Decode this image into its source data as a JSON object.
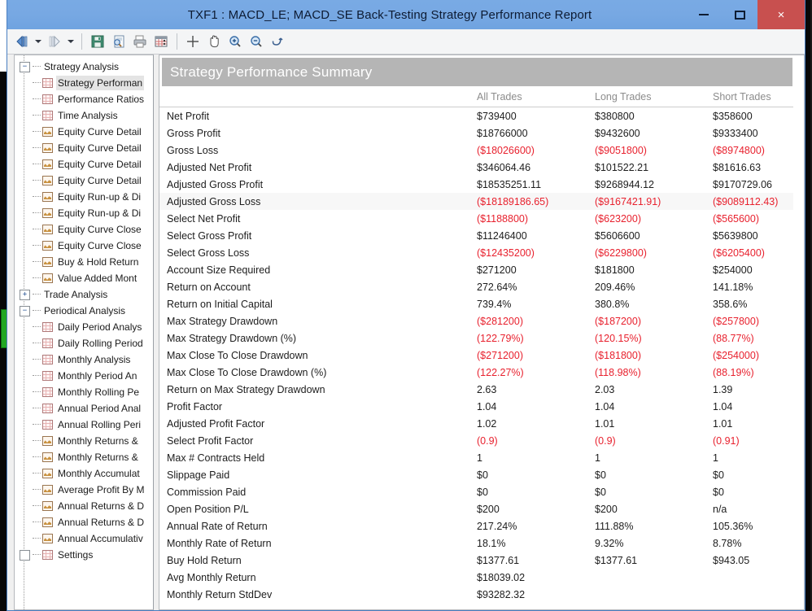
{
  "window": {
    "title": "TXF1 : MACD_LE; MACD_SE Back-Testing Strategy Performance Report",
    "minimize_label": "",
    "maximize_label": "",
    "close_label": "×",
    "accent_titlebar": "#79aae4",
    "accent_close": "#c8504f"
  },
  "toolbar": {
    "items": [
      {
        "name": "back-button",
        "glyph": "◁"
      },
      {
        "name": "back-dropdown",
        "glyph": ""
      },
      {
        "name": "forward-button",
        "glyph": "▷"
      },
      {
        "name": "forward-dropdown",
        "glyph": ""
      },
      {
        "name": "save-button",
        "glyph": ""
      },
      {
        "name": "print-preview-button",
        "glyph": ""
      },
      {
        "name": "print-button",
        "glyph": ""
      },
      {
        "name": "report-settings-button",
        "glyph": ""
      },
      {
        "name": "crosshair-button",
        "glyph": ""
      },
      {
        "name": "pan-hand-button",
        "glyph": ""
      },
      {
        "name": "zoom-in-button",
        "glyph": ""
      },
      {
        "name": "zoom-out-button",
        "glyph": ""
      },
      {
        "name": "reset-zoom-button",
        "glyph": ""
      }
    ]
  },
  "sidebar": {
    "items": [
      {
        "label": "Strategy Analysis",
        "level": 0,
        "icon": "expander-minus",
        "expander": "−",
        "selected": false
      },
      {
        "label": "Strategy Performan",
        "level": 1,
        "icon": "grid",
        "selected": true
      },
      {
        "label": "Performance Ratios",
        "level": 1,
        "icon": "grid",
        "selected": false
      },
      {
        "label": "Time Analysis",
        "level": 1,
        "icon": "grid",
        "selected": false
      },
      {
        "label": "Equity Curve Detail",
        "level": 1,
        "icon": "chart",
        "selected": false
      },
      {
        "label": "Equity Curve Detail",
        "level": 1,
        "icon": "chart",
        "selected": false
      },
      {
        "label": "Equity Curve Detail",
        "level": 1,
        "icon": "chart",
        "selected": false
      },
      {
        "label": "Equity Curve Detail",
        "level": 1,
        "icon": "chart",
        "selected": false
      },
      {
        "label": "Equity Run-up & Di",
        "level": 1,
        "icon": "chart",
        "selected": false
      },
      {
        "label": "Equity Run-up & Di",
        "level": 1,
        "icon": "chart",
        "selected": false
      },
      {
        "label": "Equity Curve Close",
        "level": 1,
        "icon": "chart",
        "selected": false
      },
      {
        "label": "Equity Curve Close",
        "level": 1,
        "icon": "chart",
        "selected": false
      },
      {
        "label": "Buy & Hold Return",
        "level": 1,
        "icon": "chart",
        "selected": false
      },
      {
        "label": "Value Added Mont",
        "level": 1,
        "icon": "chart",
        "selected": false
      },
      {
        "label": "Trade Analysis",
        "level": 0,
        "icon": "expander-plus",
        "expander": "+",
        "selected": false
      },
      {
        "label": "Periodical Analysis",
        "level": 0,
        "icon": "expander-minus",
        "expander": "−",
        "selected": false
      },
      {
        "label": "Daily Period Analys",
        "level": 1,
        "icon": "grid",
        "selected": false
      },
      {
        "label": "Daily Rolling Period",
        "level": 1,
        "icon": "grid",
        "selected": false
      },
      {
        "label": "Monthly Analysis",
        "level": 1,
        "icon": "grid",
        "selected": false
      },
      {
        "label": "Monthly Period An",
        "level": 1,
        "icon": "grid",
        "selected": false
      },
      {
        "label": "Monthly Rolling Pe",
        "level": 1,
        "icon": "grid",
        "selected": false
      },
      {
        "label": "Annual Period Anal",
        "level": 1,
        "icon": "grid",
        "selected": false
      },
      {
        "label": "Annual Rolling Peri",
        "level": 1,
        "icon": "grid",
        "selected": false
      },
      {
        "label": "Monthly Returns &",
        "level": 1,
        "icon": "chart",
        "selected": false
      },
      {
        "label": "Monthly Returns &",
        "level": 1,
        "icon": "chart",
        "selected": false
      },
      {
        "label": "Monthly Accumulat",
        "level": 1,
        "icon": "chart",
        "selected": false
      },
      {
        "label": "Average Profit By M",
        "level": 1,
        "icon": "chart",
        "selected": false
      },
      {
        "label": "Annual Returns & D",
        "level": 1,
        "icon": "chart",
        "selected": false
      },
      {
        "label": "Annual Returns & D",
        "level": 1,
        "icon": "chart",
        "selected": false
      },
      {
        "label": "Annual Accumulativ",
        "level": 1,
        "icon": "chart",
        "selected": false
      },
      {
        "label": "Settings",
        "level": 0,
        "icon": "grid",
        "selected": false
      }
    ]
  },
  "report": {
    "banner_title": "Strategy Performance Summary",
    "columns": [
      "",
      "All Trades",
      "Long Trades",
      "Short Trades"
    ],
    "rows": [
      {
        "label": "Net Profit",
        "all": "$739400",
        "long": "$380800",
        "short": "$358600",
        "negative": false,
        "alt": false
      },
      {
        "label": "Gross Profit",
        "all": "$18766000",
        "long": "$9432600",
        "short": "$9333400",
        "negative": false,
        "alt": false
      },
      {
        "label": "Gross Loss",
        "all": "($18026600)",
        "long": "($9051800)",
        "short": "($8974800)",
        "negative": true,
        "alt": false
      },
      {
        "label": "Adjusted Net Profit",
        "all": "$346064.46",
        "long": "$101522.21",
        "short": "$81616.63",
        "negative": false,
        "alt": false
      },
      {
        "label": "Adjusted Gross Profit",
        "all": "$18535251.11",
        "long": "$9268944.12",
        "short": "$9170729.06",
        "negative": false,
        "alt": false
      },
      {
        "label": "Adjusted Gross Loss",
        "all": "($18189186.65)",
        "long": "($9167421.91)",
        "short": "($9089112.43)",
        "negative": true,
        "alt": true
      },
      {
        "label": "Select Net Profit",
        "all": "($1188800)",
        "long": "($623200)",
        "short": "($565600)",
        "negative": true,
        "alt": false
      },
      {
        "label": "Select Gross Profit",
        "all": "$11246400",
        "long": "$5606600",
        "short": "$5639800",
        "negative": false,
        "alt": false
      },
      {
        "label": "Select Gross Loss",
        "all": "($12435200)",
        "long": "($6229800)",
        "short": "($6205400)",
        "negative": true,
        "alt": false
      },
      {
        "label": "Account Size Required",
        "all": "$271200",
        "long": "$181800",
        "short": "$254000",
        "negative": false,
        "alt": false
      },
      {
        "label": "Return on Account",
        "all": "272.64%",
        "long": "209.46%",
        "short": "141.18%",
        "negative": false,
        "alt": false
      },
      {
        "label": "Return on Initial Capital",
        "all": "739.4%",
        "long": "380.8%",
        "short": "358.6%",
        "negative": false,
        "alt": false
      },
      {
        "label": "Max Strategy Drawdown",
        "all": "($281200)",
        "long": "($187200)",
        "short": "($257800)",
        "negative": true,
        "alt": false
      },
      {
        "label": "Max Strategy Drawdown (%)",
        "all": "(122.79%)",
        "long": "(120.15%)",
        "short": "(88.77%)",
        "negative": true,
        "alt": false
      },
      {
        "label": "Max Close To Close Drawdown",
        "all": "($271200)",
        "long": "($181800)",
        "short": "($254000)",
        "negative": true,
        "alt": false
      },
      {
        "label": "Max Close To Close Drawdown (%)",
        "all": "(122.27%)",
        "long": "(118.98%)",
        "short": "(88.19%)",
        "negative": true,
        "alt": false
      },
      {
        "label": "Return on Max Strategy Drawdown",
        "all": "2.63",
        "long": "2.03",
        "short": "1.39",
        "negative": false,
        "alt": false
      },
      {
        "label": "Profit Factor",
        "all": "1.04",
        "long": "1.04",
        "short": "1.04",
        "negative": false,
        "alt": false
      },
      {
        "label": "Adjusted Profit Factor",
        "all": "1.02",
        "long": "1.01",
        "short": "1.01",
        "negative": false,
        "alt": false
      },
      {
        "label": "Select Profit Factor",
        "all": "(0.9)",
        "long": "(0.9)",
        "short": "(0.91)",
        "negative": true,
        "alt": false
      },
      {
        "label": "Max # Contracts Held",
        "all": "1",
        "long": "1",
        "short": "1",
        "negative": false,
        "alt": false
      },
      {
        "label": "Slippage Paid",
        "all": "$0",
        "long": "$0",
        "short": "$0",
        "negative": false,
        "alt": false
      },
      {
        "label": "Commission Paid",
        "all": "$0",
        "long": "$0",
        "short": "$0",
        "negative": false,
        "alt": false
      },
      {
        "label": "Open Position P/L",
        "all": "$200",
        "long": "$200",
        "short": "n/a",
        "negative": false,
        "alt": false
      },
      {
        "label": "Annual Rate of Return",
        "all": "217.24%",
        "long": "111.88%",
        "short": "105.36%",
        "negative": false,
        "alt": false
      },
      {
        "label": "Monthly Rate of Return",
        "all": "18.1%",
        "long": "9.32%",
        "short": "8.78%",
        "negative": false,
        "alt": false
      },
      {
        "label": "Buy  Hold Return",
        "all": "$1377.61",
        "long": "$1377.61",
        "short": "$943.05",
        "negative": false,
        "alt": false
      },
      {
        "label": "Avg Monthly Return",
        "all": "$18039.02",
        "long": "",
        "short": "",
        "negative": false,
        "alt": false
      },
      {
        "label": "Monthly Return StdDev",
        "all": "$93282.32",
        "long": "",
        "short": "",
        "negative": false,
        "alt": false
      }
    ]
  }
}
